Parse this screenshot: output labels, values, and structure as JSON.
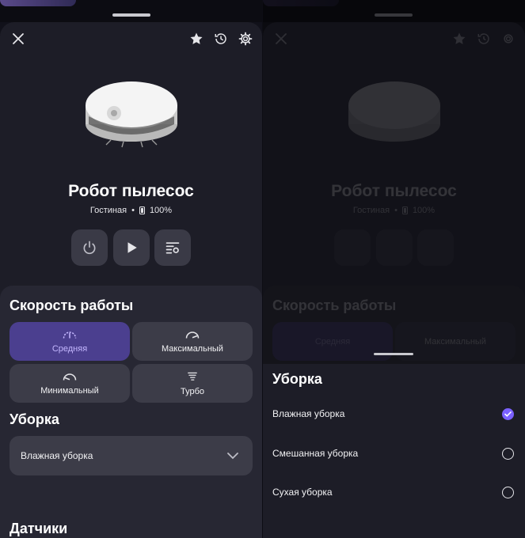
{
  "device": {
    "title": "Робот пылесос",
    "room": "Гостиная",
    "separator": "•",
    "battery": "100%"
  },
  "header_icons": [
    "close-icon",
    "star-icon",
    "history-icon",
    "gear-icon"
  ],
  "controls": [
    "power-icon",
    "play-icon",
    "mode-settings-icon"
  ],
  "speed": {
    "title": "Скорость работы",
    "options": [
      {
        "label": "Средняя",
        "icon": "gauge-medium-icon",
        "selected": true
      },
      {
        "label": "Максимальный",
        "icon": "gauge-max-icon",
        "selected": false
      },
      {
        "label": "Минимальный",
        "icon": "gauge-min-icon",
        "selected": false
      },
      {
        "label": "Турбо",
        "icon": "tornado-icon",
        "selected": false
      }
    ]
  },
  "cleaning": {
    "title": "Уборка",
    "selected": "Влажная уборка"
  },
  "sensors": {
    "title": "Датчики"
  },
  "popup": {
    "title": "Уборка",
    "options": [
      {
        "label": "Влажная уборка",
        "checked": true
      },
      {
        "label": "Смешанная уборка",
        "checked": false
      },
      {
        "label": "Сухая уборка",
        "checked": false
      }
    ]
  },
  "colors": {
    "accent": "#7b61ff",
    "selected_tile": "#4b3f8f",
    "background": "#1d1d27"
  }
}
